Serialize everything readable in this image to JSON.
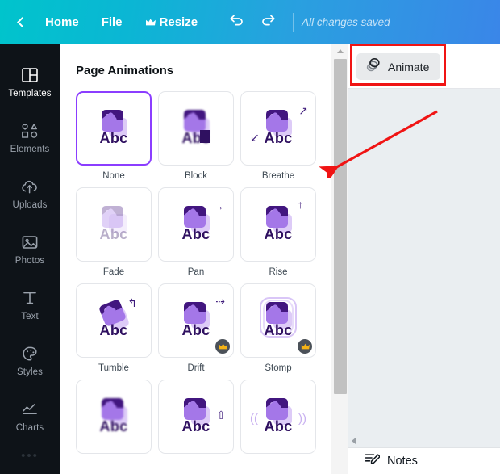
{
  "topbar": {
    "back_icon": "chevron-left-icon",
    "home_label": "Home",
    "file_label": "File",
    "resize_label": "Resize",
    "resize_icon": "crown-icon",
    "undo_icon": "undo-arrow-icon",
    "redo_icon": "redo-arrow-icon",
    "status_text": "All changes saved",
    "gradient_start": "#00c4cc",
    "gradient_end": "#3a86e8"
  },
  "sidebar": {
    "background": "#0e1318",
    "active_color": "#ffffff",
    "items": [
      {
        "label": "Templates",
        "icon": "templates-grid-icon",
        "active": true
      },
      {
        "label": "Elements",
        "icon": "shapes-icon",
        "active": false
      },
      {
        "label": "Uploads",
        "icon": "upload-cloud-icon",
        "active": false
      },
      {
        "label": "Photos",
        "icon": "photo-image-icon",
        "active": false
      },
      {
        "label": "Text",
        "icon": "text-t-icon",
        "active": false
      },
      {
        "label": "Styles",
        "icon": "palette-icon",
        "active": false
      },
      {
        "label": "Charts",
        "icon": "line-chart-icon",
        "active": false
      }
    ],
    "more_label": "•••"
  },
  "panel": {
    "title": "Page Animations",
    "selected_color": "#8b3dff",
    "animations": [
      {
        "label": "None",
        "style": "none",
        "selected": true,
        "premium": false,
        "mark": ""
      },
      {
        "label": "Block",
        "style": "block",
        "selected": false,
        "premium": false,
        "mark": ""
      },
      {
        "label": "Breathe",
        "style": "breathe",
        "selected": false,
        "premium": false,
        "mark": "↗↙"
      },
      {
        "label": "Fade",
        "style": "fade",
        "selected": false,
        "premium": false,
        "mark": ""
      },
      {
        "label": "Pan",
        "style": "pan",
        "selected": false,
        "premium": false,
        "mark": "→"
      },
      {
        "label": "Rise",
        "style": "rise",
        "selected": false,
        "premium": false,
        "mark": "↑"
      },
      {
        "label": "Tumble",
        "style": "tumble",
        "selected": false,
        "premium": false,
        "mark": "↰"
      },
      {
        "label": "Drift",
        "style": "drift",
        "selected": false,
        "premium": true,
        "mark": "⇢"
      },
      {
        "label": "Stomp",
        "style": "stomp",
        "selected": false,
        "premium": true,
        "mark": ""
      },
      {
        "label": "",
        "style": "blurrow",
        "selected": false,
        "premium": false,
        "mark": ""
      },
      {
        "label": "",
        "style": "riseup",
        "selected": false,
        "premium": false,
        "mark": "⇧"
      },
      {
        "label": "",
        "style": "shake",
        "selected": false,
        "premium": false,
        "mark": ""
      }
    ],
    "thumb_text": "Abc"
  },
  "scrollbar": {
    "up_arrow_icon": "scroll-up-arrow-icon",
    "left_arrow_icon": "scroll-left-arrow-icon"
  },
  "right_panel": {
    "animate_label": "Animate",
    "animate_icon": "animate-circles-icon",
    "notes_label": "Notes",
    "notes_icon": "notes-pencil-icon",
    "canvas_background": "#eaeef1"
  },
  "annotation": {
    "color": "#f01414",
    "highlight_target": "Animate",
    "arrow_from": "Animate button",
    "arrow_to": "panel scrollbar"
  }
}
